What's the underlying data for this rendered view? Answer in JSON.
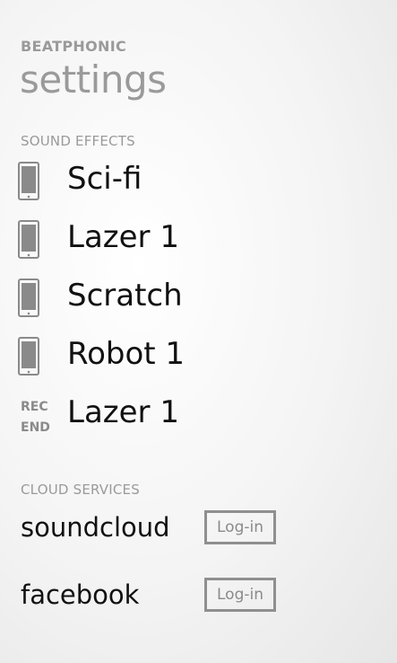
{
  "header": {
    "app_name": "BEATPHONIC",
    "page_title": "settings"
  },
  "sound_effects": {
    "section_label": "SOUND EFFECTS",
    "items": [
      {
        "label": "Sci-fi",
        "icon": "phone-icon"
      },
      {
        "label": "Lazer 1",
        "icon": "phone-icon"
      },
      {
        "label": "Scratch",
        "icon": "phone-icon"
      },
      {
        "label": "Robot 1",
        "icon": "phone-icon"
      },
      {
        "label": "Lazer 1",
        "icon": "rec-end-icon",
        "icon_text_1": "REC",
        "icon_text_2": "END"
      }
    ]
  },
  "cloud_services": {
    "section_label": "CLOUD SERVICES",
    "items": [
      {
        "name": "soundcloud",
        "button_label": "Log-in"
      },
      {
        "name": "facebook",
        "button_label": "Log-in"
      }
    ]
  },
  "colors": {
    "muted_text": "#9a9a9a",
    "primary_text": "#111111",
    "icon_gray": "#8a8a8a"
  }
}
